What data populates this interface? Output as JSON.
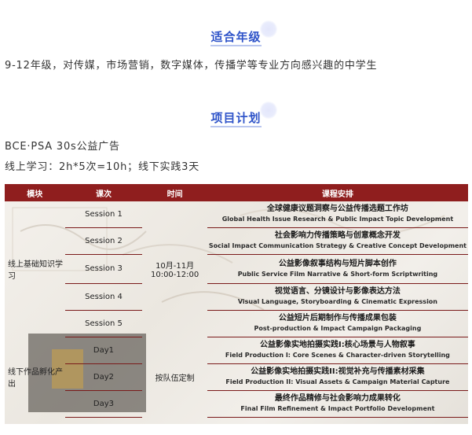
{
  "sections": {
    "grade": {
      "title": "适合年级",
      "text": "9-12年级，对传媒，市场营销，数字媒体，传播学等专业方向感兴趣的中学生"
    },
    "plan": {
      "title": "项目计划",
      "line1": "BCE·PSA 30s公益广告",
      "line2": "线上学习：2h*5次=10h；线下实践3天"
    }
  },
  "table": {
    "headers": [
      "模块",
      "课次",
      "时间",
      "课程安排"
    ],
    "groups": [
      {
        "module": "线上基础知识学习",
        "time": "10月-11月\n10:00-12:00",
        "rows": [
          {
            "session": "Session 1",
            "cn": "全球健康议题洞察与公益传播选题工作坊",
            "en": "Global Health Issue Research & Public Impact Topic Development"
          },
          {
            "session": "Session 2",
            "cn": "社会影响力传播策略与创意概念开发",
            "en": "Social Impact Communication Strategy & Creative Concept Development"
          },
          {
            "session": "Session 3",
            "cn": "公益影像叙事结构与短片脚本创作",
            "en": "Public Service Film Narrative & Short-form Scriptwriting"
          },
          {
            "session": "Session 4",
            "cn": "视觉语言、分镜设计与影像表达方法",
            "en": "Visual Language, Storyboarding & Cinematic Expression"
          },
          {
            "session": "Session 5",
            "cn": "公益短片后期制作与传播成果包装",
            "en": "Post-production & Impact Campaign Packaging"
          }
        ]
      },
      {
        "module": "线下作品孵化产出",
        "time": "按队伍定制",
        "rows": [
          {
            "session": "Day1",
            "cn": "公益影像实地拍摄实践I:核心场景与人物叙事",
            "en": "Field Production I: Core Scenes & Character-driven Storytelling"
          },
          {
            "session": "Day2",
            "cn": "公益影像实地拍摄实践II:视觉补充与传播素材采集",
            "en": "Field Production II: Visual Assets & Campaign Material Capture"
          },
          {
            "session": "Day3",
            "cn": "最终作品精修与社会影响力成果转化",
            "en": "Final Film Refinement & Impact Portfolio Development"
          }
        ]
      }
    ]
  },
  "colors": {
    "title_blue": "#2f54c9",
    "header_red": "#8f1e1e"
  }
}
